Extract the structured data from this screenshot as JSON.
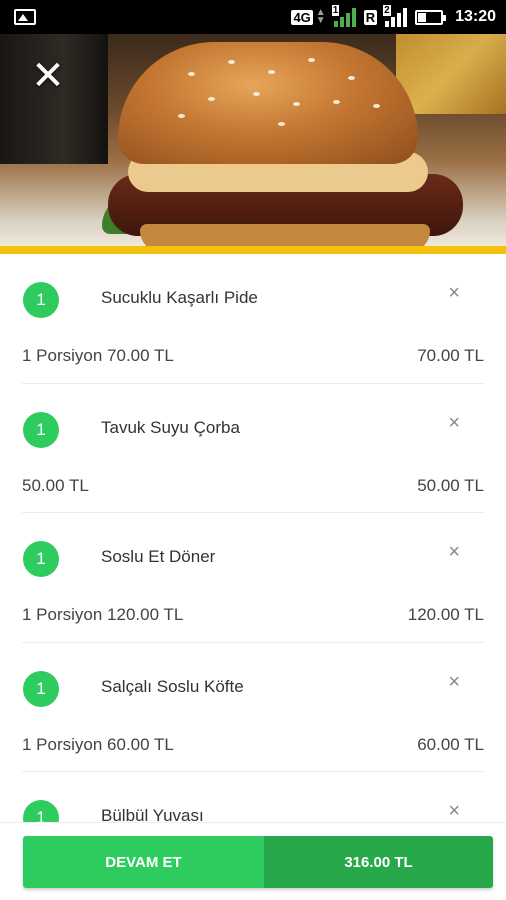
{
  "status_bar": {
    "network": "4G",
    "sim1": "1",
    "roaming": "R",
    "sim2": "2",
    "time": "13:20",
    "icons": [
      "gallery-icon",
      "signal-icon",
      "battery-icon"
    ]
  },
  "header": {
    "close_symbol": "✕"
  },
  "colors": {
    "accent": "#f4c20d",
    "green": "#2ecc5e",
    "green_dark": "#27a84b"
  },
  "cart": {
    "items": [
      {
        "qty": "1",
        "name": "Sucuklu Kaşarlı Pide",
        "detail": "1 Porsiyon 70.00 TL",
        "price": "70.00 TL",
        "remove": "×"
      },
      {
        "qty": "1",
        "name": "Tavuk Suyu Çorba",
        "detail": "50.00 TL",
        "price": "50.00 TL",
        "remove": "×"
      },
      {
        "qty": "1",
        "name": "Soslu Et Döner",
        "detail": "1 Porsiyon 120.00 TL",
        "price": "120.00 TL",
        "remove": "×"
      },
      {
        "qty": "1",
        "name": "Salçalı Soslu Köfte",
        "detail": "1 Porsiyon 60.00 TL",
        "price": "60.00 TL",
        "remove": "×"
      },
      {
        "qty": "1",
        "name": "Bülbül Yuvası",
        "detail": "",
        "price": "",
        "remove": "×"
      }
    ]
  },
  "footer": {
    "continue_label": "DEVAM ET",
    "total": "316.00 TL"
  }
}
